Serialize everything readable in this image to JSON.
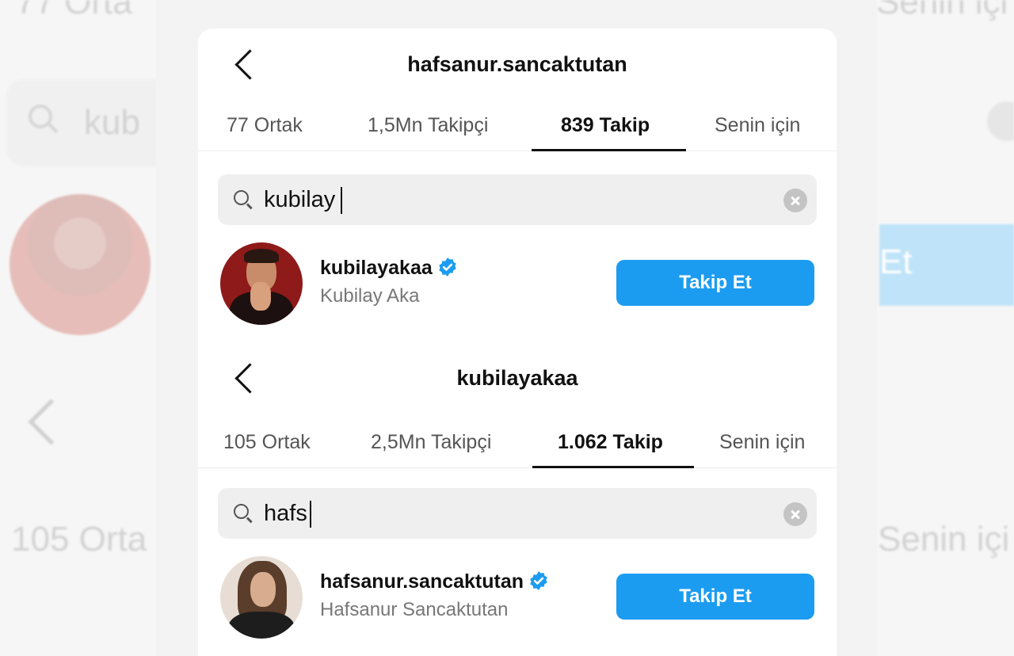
{
  "background": {
    "tl_text": "77 Orta",
    "tr_text": "Senin içi",
    "search_text": "kub",
    "button_text": "Et",
    "ml_text": "105 Orta",
    "mr_text": "Senin içi"
  },
  "accent": "#1c9cf0",
  "screens": [
    {
      "title": "hafsanur.sancaktutan",
      "tabs": [
        "77 Ortak",
        "1,5Mn Takipçi",
        "839 Takip",
        "Senin için"
      ],
      "active_tab": "839 Takip",
      "search": {
        "value": "kubilay"
      },
      "result": {
        "username": "kubilayakaa",
        "full_name": "Kubilay Aka",
        "verified": true,
        "button": "Takip Et"
      }
    },
    {
      "title": "kubilayakaa",
      "tabs": [
        "105 Ortak",
        "2,5Mn Takipçi",
        "1.062 Takip",
        "Senin için"
      ],
      "active_tab": "1.062 Takip",
      "search": {
        "value": "hafs"
      },
      "result": {
        "username": "hafsanur.sancaktutan",
        "full_name": "Hafsanur Sancaktutan",
        "verified": true,
        "button": "Takip Et"
      }
    }
  ]
}
